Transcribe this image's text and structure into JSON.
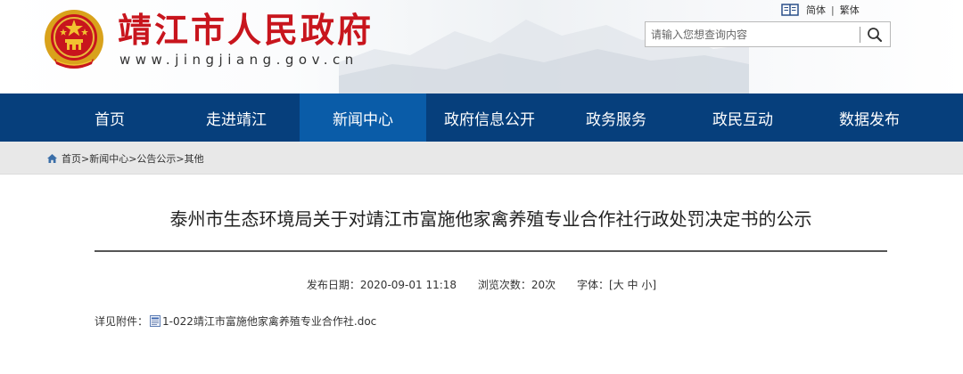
{
  "header": {
    "site_title": "靖江市人民政府",
    "site_url": "www.jingjiang.gov.cn",
    "lang_simplified": "简体",
    "lang_separator": "|",
    "lang_traditional": "繁体",
    "search_placeholder": "请输入您想查询内容",
    "icons": [
      "national-emblem-icon",
      "book-icon",
      "magnifier-icon"
    ]
  },
  "nav": {
    "items": [
      {
        "label": "首页"
      },
      {
        "label": "走进靖江"
      },
      {
        "label": "新闻中心",
        "active": true
      },
      {
        "label": "政府信息公开"
      },
      {
        "label": "政务服务"
      },
      {
        "label": "政民互动"
      },
      {
        "label": "数据发布"
      }
    ]
  },
  "breadcrumb": {
    "text": "首页>新闻中心>公告公示>其他",
    "icon": "home-icon"
  },
  "article": {
    "title": "泰州市生态环境局关于对靖江市富施他家禽养殖专业合作社行政处罚决定书的公示",
    "publish_date": "发布日期：2020-09-01 11:18",
    "views": "浏览次数：20次",
    "font_size_label": "字体：",
    "font_size_open": "[",
    "font_large": "大",
    "font_medium": "中",
    "font_small": "小",
    "font_size_close": "]",
    "attachment_label": "详见附件：",
    "attachment_name": "1-022靖江市富施他家禽养殖专业合作社.doc"
  },
  "colors": {
    "nav_bg": "#063f7c",
    "nav_active": "#0a5ca8",
    "title_red": "#c8151d",
    "crumb_bg": "#e8e8e8"
  }
}
